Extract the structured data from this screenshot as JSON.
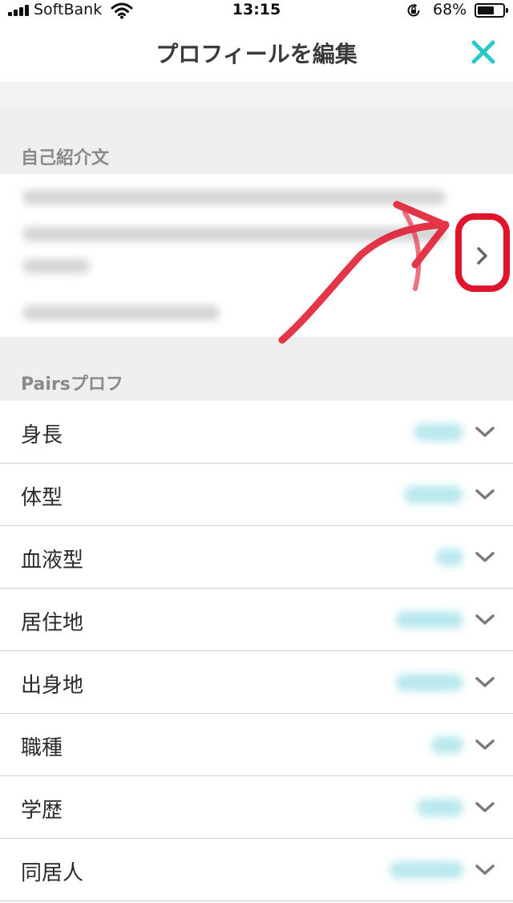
{
  "status_bar": {
    "carrier": "SoftBank",
    "time": "13:15",
    "battery_percent": "68%",
    "battery_level": 0.68,
    "icons": [
      "signal-icon",
      "wifi-icon",
      "rotation-lock-icon",
      "battery-icon"
    ]
  },
  "nav": {
    "title": "プロフィールを編集",
    "close_icon": "close-icon",
    "accent_color": "#2cc7c7"
  },
  "intro_section": {
    "header": "自己紹介文",
    "chevron_icon": "chevron-right-icon"
  },
  "pairs_section": {
    "header": "Pairsプロフ",
    "rows": [
      {
        "label": "身長",
        "icon": "chevron-down-icon"
      },
      {
        "label": "体型",
        "icon": "chevron-down-icon"
      },
      {
        "label": "血液型",
        "icon": "chevron-down-icon"
      },
      {
        "label": "居住地",
        "icon": "chevron-down-icon"
      },
      {
        "label": "出身地",
        "icon": "chevron-down-icon"
      },
      {
        "label": "職種",
        "icon": "chevron-down-icon"
      },
      {
        "label": "学歴",
        "icon": "chevron-down-icon"
      },
      {
        "label": "同居人",
        "icon": "chevron-down-icon"
      }
    ]
  },
  "annotation": {
    "color": "#e0142a",
    "shapes": [
      "arrow",
      "rounded-rectangle-highlight"
    ]
  }
}
